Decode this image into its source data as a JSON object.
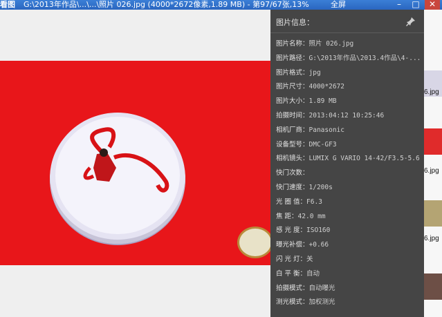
{
  "window": {
    "app_name": "看图",
    "title": "G:\\2013年作品\\...\\...\\照片 026.jpg (4000*2672像素,1.89 MB) - 第97/67张,13%",
    "extra": "全屏",
    "minimize_glyph": "–",
    "maximize_glyph": "□",
    "close_glyph": "✕"
  },
  "info_panel": {
    "title": "图片信息：",
    "pin_icon": "pin-icon",
    "rows": [
      {
        "label": "图片名称：",
        "value": "照片 026.jpg"
      },
      {
        "label": "图片路径：",
        "value": "G:\\2013年作品\\2013.4作品\\4-..."
      },
      {
        "label": "图片格式：",
        "value": "jpg"
      },
      {
        "label": "图片尺寸：",
        "value": "4000*2672"
      },
      {
        "label": "图片大小：",
        "value": "1.89 MB"
      },
      {
        "label": "拍摄时间：",
        "value": "2013:04:12 10:25:46"
      },
      {
        "label": "相机厂商：",
        "value": "Panasonic"
      },
      {
        "label": "设备型号：",
        "value": "DMC-GF3"
      },
      {
        "label": "相机镜头：",
        "value": "LUMIX G VARIO 14-42/F3.5-5.6"
      },
      {
        "label": "快门次数：",
        "value": ""
      },
      {
        "label": "快门速度：",
        "value": "1/200s"
      },
      {
        "label": "光 圈 值：",
        "value": "F6.3"
      },
      {
        "label": "焦    距：",
        "value": "42.0 mm"
      },
      {
        "label": "感 光 度：",
        "value": "ISO160"
      },
      {
        "label": "曝光补偿：",
        "value": "+0.66"
      },
      {
        "label": "闪 光 灯：",
        "value": "关"
      },
      {
        "label": "白 平 衡：",
        "value": "自动"
      },
      {
        "label": "拍摄模式：",
        "value": "自动曝光"
      },
      {
        "label": "测光模式：",
        "value": "加权测光"
      }
    ]
  },
  "thumbnails": [
    {
      "label": "6.jpg"
    },
    {
      "label": "6.jpg"
    },
    {
      "label": "6.jpg"
    }
  ],
  "colors": {
    "photo_background": "#e8161a",
    "panel_background": "#454545",
    "titlebar": "#2a66c0"
  }
}
